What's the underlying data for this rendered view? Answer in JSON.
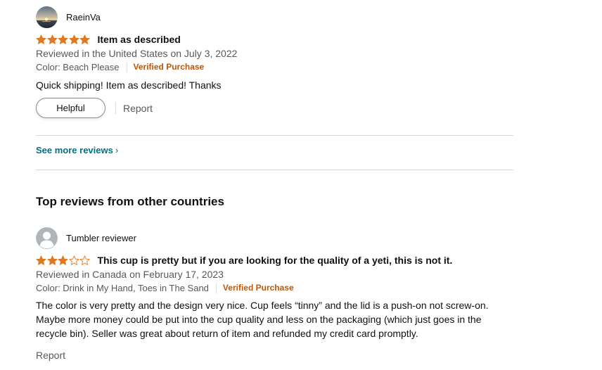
{
  "review1": {
    "profile_name": "RaeinVa",
    "rating": 5,
    "title": "Item as described",
    "date_line": "Reviewed in the United States on July 3, 2022",
    "color_line": "Color: Beach Please",
    "verified": "Verified Purchase",
    "body": "Quick shipping! Item as described! Thanks",
    "helpful_label": "Helpful",
    "report_label": "Report"
  },
  "see_more": {
    "label": "See more reviews",
    "chevron": "›"
  },
  "section_title": "Top reviews from other countries",
  "review2": {
    "profile_name": "Tumbler reviewer",
    "rating": 3,
    "title": "This cup is pretty but if you are looking for the quality of a yeti, this is not it.",
    "date_line": "Reviewed in Canada on February 17, 2023",
    "color_line": "Color: Drink in My Hand, Toes in The Sand",
    "verified": "Verified Purchase",
    "body": "The color is very pretty and the design very nice. Cup feels “tinny” and the lid is a push-on not screw-on. Maybe more money could be put into the cup quality and less on the packaging (which just goes in the recycle bin). Seller was great about return of item and refunded my credit card promptly.",
    "report_label": "Report"
  },
  "colors": {
    "star_fill": "#de7921",
    "link": "#007185",
    "verified": "#c45500",
    "muted_text": "#565959"
  },
  "icons": {
    "avatar1": "sunset-photo-avatar",
    "avatar2": "default-user-avatar",
    "star": "star-icon"
  }
}
